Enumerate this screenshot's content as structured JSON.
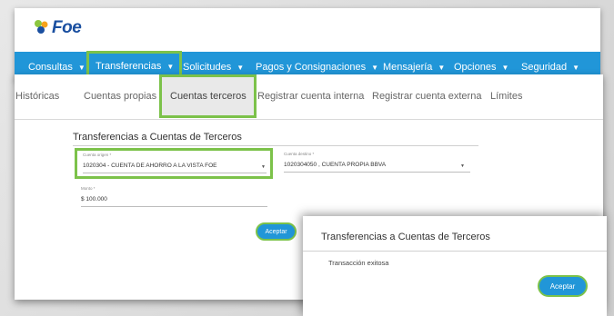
{
  "app": {
    "logo_text": "Foe",
    "colors": {
      "nav": "#2196d8",
      "highlight": "#7cc24a",
      "logo": "#1a4fa0"
    }
  },
  "nav": {
    "items": [
      {
        "label": "Consultas"
      },
      {
        "label": "Transferencias"
      },
      {
        "label": "Solicitudes"
      },
      {
        "label": "Pagos y Consignaciones"
      },
      {
        "label": "Mensajería"
      },
      {
        "label": "Opciones"
      },
      {
        "label": "Seguridad"
      }
    ],
    "caret": "▼"
  },
  "subnav": {
    "items": [
      {
        "label": "Históricas"
      },
      {
        "label": "Cuentas propias"
      },
      {
        "label": "Cuentas terceros"
      },
      {
        "label": "Registrar cuenta interna"
      },
      {
        "label": "Registrar cuenta externa"
      },
      {
        "label": "Límites"
      }
    ]
  },
  "form": {
    "title": "Transferencias a Cuentas de Terceros",
    "origin": {
      "label": "Cuenta origen *",
      "value": "1020304  - CUENTA DE AHORRO A LA VISTA FOE"
    },
    "destination": {
      "label": "Cuenta destino *",
      "value": "1020304050    ,    CUENTA PROPIA BBVA"
    },
    "amount": {
      "label": "Monto *",
      "value": "$ 100.000"
    },
    "accept_label": "Aceptar",
    "caret": "▼"
  },
  "dialog": {
    "title": "Transferencias a Cuentas de Terceros",
    "message": "Transacción exitosa",
    "accept_label": "Aceptar"
  }
}
